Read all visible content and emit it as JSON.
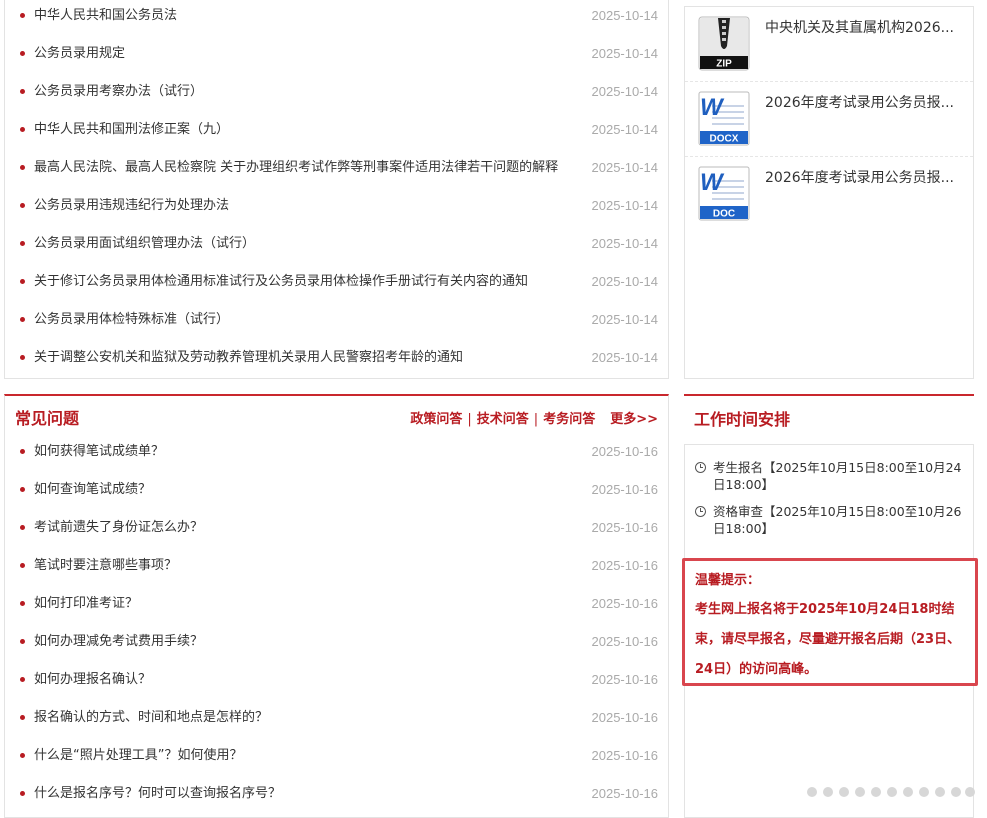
{
  "laws": {
    "items": [
      {
        "title": "中华人民共和国公务员法",
        "date": "2025-10-14"
      },
      {
        "title": "公务员录用规定",
        "date": "2025-10-14"
      },
      {
        "title": "公务员录用考察办法（试行）",
        "date": "2025-10-14"
      },
      {
        "title": "中华人民共和国刑法修正案（九）",
        "date": "2025-10-14"
      },
      {
        "title": "最高人民法院、最高人民检察院 关于办理组织考试作弊等刑事案件适用法律若干问题的解释",
        "date": "2025-10-14"
      },
      {
        "title": "公务员录用违规违纪行为处理办法",
        "date": "2025-10-14"
      },
      {
        "title": "公务员录用面试组织管理办法（试行）",
        "date": "2025-10-14"
      },
      {
        "title": "关于修订公务员录用体检通用标准试行及公务员录用体检操作手册试行有关内容的通知",
        "date": "2025-10-14"
      },
      {
        "title": "公务员录用体检特殊标准（试行）",
        "date": "2025-10-14"
      },
      {
        "title": "关于调整公安机关和监狱及劳动教养管理机关录用人民警察招考年龄的通知",
        "date": "2025-10-14"
      }
    ]
  },
  "faq": {
    "title": "常见问题",
    "links": [
      "政策问答",
      "技术问答",
      "考务问答",
      "更多>>"
    ],
    "items": [
      {
        "title": "如何获得笔试成绩单？",
        "date": "2025-10-16"
      },
      {
        "title": "如何查询笔试成绩？",
        "date": "2025-10-16"
      },
      {
        "title": "考试前遗失了身份证怎么办？",
        "date": "2025-10-16"
      },
      {
        "title": "笔试时要注意哪些事项？",
        "date": "2025-10-16"
      },
      {
        "title": "如何打印准考证？",
        "date": "2025-10-16"
      },
      {
        "title": "如何办理减免考试费用手续？",
        "date": "2025-10-16"
      },
      {
        "title": "如何办理报名确认？",
        "date": "2025-10-16"
      },
      {
        "title": "报名确认的方式、时间和地点是怎样的？",
        "date": "2025-10-16"
      },
      {
        "title": "什么是“照片处理工具”？如何使用？",
        "date": "2025-10-16"
      },
      {
        "title": "什么是报名序号？何时可以查询报名序号？",
        "date": "2025-10-16"
      }
    ]
  },
  "downloads": {
    "items": [
      {
        "type": "ZIP",
        "icon": "zip-file-icon",
        "title": "中央机关及其直属机构2026..."
      },
      {
        "type": "DOCX",
        "icon": "docx-file-icon",
        "title": "2026年度考试录用公务员报..."
      },
      {
        "type": "DOC",
        "icon": "doc-file-icon",
        "title": "2026年度考试录用公务员报..."
      }
    ]
  },
  "schedule": {
    "title": "工作时间安排",
    "items": [
      {
        "text": "考生报名【2025年10月15日8:00至10月24日18:00】"
      },
      {
        "text": "资格审查【2025年10月15日8:00至10月26日18:00】"
      }
    ]
  },
  "tip": {
    "title": "温馨提示：",
    "body": "考生网上报名将于2025年10月24日18时结束，请尽早报名，尽量避开报名后期（23日、24日）的访问高峰。"
  },
  "colors": {
    "accent": "#b81c22",
    "border_red": "#c9272d",
    "tip_border": "#d9464e",
    "date": "#aaaaaa"
  }
}
